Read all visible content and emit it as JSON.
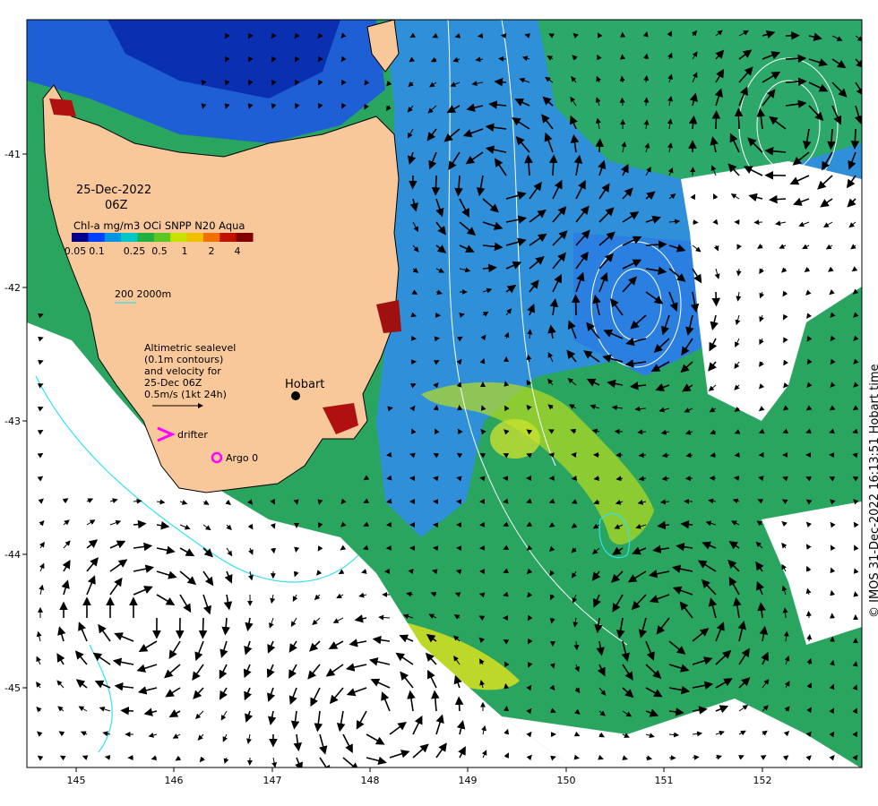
{
  "map": {
    "date": "25-Dec-2022",
    "time": "06Z",
    "colorbar_title": "Chl-a mg/m3 OCi SNPP N20 Aqua",
    "colorbar_ticks": [
      "0.05",
      "0.1",
      "0.25",
      "0.5",
      "1",
      "2",
      "4"
    ],
    "colorbar_colors": [
      "#00008b",
      "#0040ff",
      "#0096e0",
      "#00c8c8",
      "#20b040",
      "#5ac820",
      "#c8e000",
      "#f0c000",
      "#f07000",
      "#c01000",
      "#800000"
    ],
    "depth_contours_label": "200  2000m",
    "velocity_note_lines": [
      "Altimetric sealevel",
      "(0.1m contours)",
      "and velocity for",
      "25-Dec 06Z",
      "0.5m/s (1kt 24h)"
    ],
    "drifter_label": "drifter",
    "argo_label": "Argo 0",
    "city_label": "Hobart",
    "credit": "© IMOS 31-Dec-2022 16:13:51 Hobart time",
    "lon_ticks": [
      "145",
      "146",
      "147",
      "148",
      "149",
      "150",
      "151",
      "152"
    ],
    "lat_ticks": [
      "-41",
      "-42",
      "-43",
      "-44",
      "-45"
    ]
  }
}
